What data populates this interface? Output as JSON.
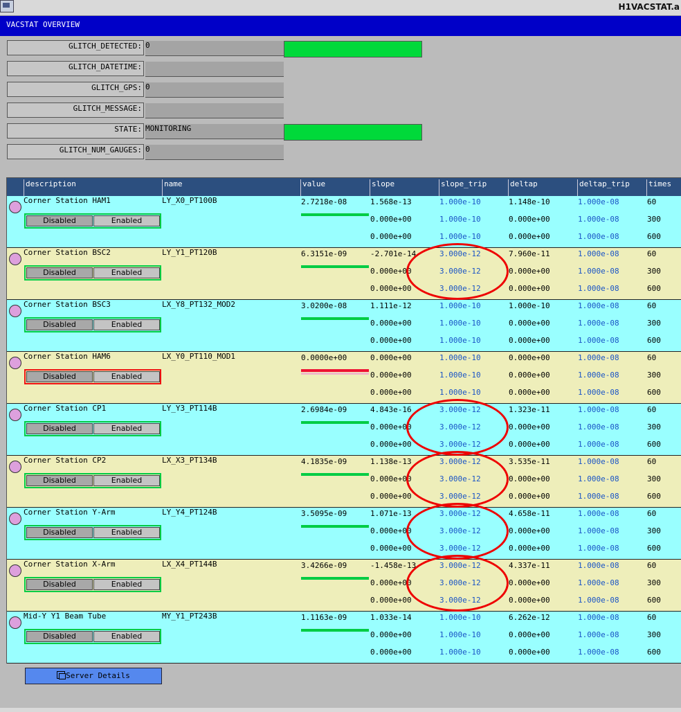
{
  "window": {
    "title": "H1VACSTAT.a"
  },
  "header": {
    "title": "VACSTAT OVERVIEW"
  },
  "fields": [
    {
      "label": "GLITCH_DETECTED:",
      "value": "0",
      "indicator_color": "#00d93a"
    },
    {
      "label": "GLITCH_DATETIME:",
      "value": ""
    },
    {
      "label": "GLITCH_GPS:",
      "value": "0"
    },
    {
      "label": "GLITCH_MESSAGE:",
      "value": ""
    },
    {
      "label": "STATE:",
      "value": "MONITORING",
      "indicator_color": "#00d93a"
    },
    {
      "label": "GLITCH_NUM_GAUGES:",
      "value": "0"
    }
  ],
  "table": {
    "columns": [
      "description",
      "name",
      "value",
      "slope",
      "slope_trip",
      "deltap",
      "deltap_trip",
      "times"
    ],
    "toggle": {
      "disabled_label": "Disabled",
      "enabled_label": "Enabled"
    },
    "rows": [
      {
        "description": "Corner Station HAM1",
        "name": "LY_X0_PT100B",
        "value": "2.7218e-08",
        "status": "ok",
        "slope": [
          "1.568e-13",
          "0.000e+00",
          "0.000e+00"
        ],
        "slope_trip": [
          "1.000e-10",
          "1.000e-10",
          "1.000e-10"
        ],
        "deltap": [
          "1.148e-10",
          "0.000e+00",
          "0.000e+00"
        ],
        "deltap_trip": [
          "1.000e-08",
          "1.000e-08",
          "1.000e-08"
        ],
        "times": [
          "60",
          "300",
          "600"
        ]
      },
      {
        "description": "Corner Station BSC2",
        "name": "LY_Y1_PT120B",
        "value": "6.3151e-09",
        "status": "ok",
        "slope": [
          "-2.701e-14",
          "0.000e+00",
          "0.000e+00"
        ],
        "slope_trip": [
          "3.000e-12",
          "3.000e-12",
          "3.000e-12"
        ],
        "deltap": [
          "7.960e-11",
          "0.000e+00",
          "0.000e+00"
        ],
        "deltap_trip": [
          "1.000e-08",
          "1.000e-08",
          "1.000e-08"
        ],
        "times": [
          "60",
          "300",
          "600"
        ]
      },
      {
        "description": "Corner Station BSC3",
        "name": "LX_Y8_PT132_MOD2",
        "value": "3.0200e-08",
        "status": "ok",
        "slope": [
          "1.111e-12",
          "0.000e+00",
          "0.000e+00"
        ],
        "slope_trip": [
          "1.000e-10",
          "1.000e-10",
          "1.000e-10"
        ],
        "deltap": [
          "1.000e-10",
          "0.000e+00",
          "0.000e+00"
        ],
        "deltap_trip": [
          "1.000e-08",
          "1.000e-08",
          "1.000e-08"
        ],
        "times": [
          "60",
          "300",
          "600"
        ]
      },
      {
        "description": "Corner Station HAM6",
        "name": "LX_Y0_PT110_MOD1",
        "value": "0.0000e+00",
        "status": "fault",
        "slope": [
          "0.000e+00",
          "0.000e+00",
          "0.000e+00"
        ],
        "slope_trip": [
          "1.000e-10",
          "1.000e-10",
          "1.000e-10"
        ],
        "deltap": [
          "0.000e+00",
          "0.000e+00",
          "0.000e+00"
        ],
        "deltap_trip": [
          "1.000e-08",
          "1.000e-08",
          "1.000e-08"
        ],
        "times": [
          "60",
          "300",
          "600"
        ]
      },
      {
        "description": "Corner Station CP1",
        "name": "LY_Y3_PT114B",
        "value": "2.6984e-09",
        "status": "ok",
        "slope": [
          "4.843e-16",
          "0.000e+00",
          "0.000e+00"
        ],
        "slope_trip": [
          "3.000e-12",
          "3.000e-12",
          "3.000e-12"
        ],
        "deltap": [
          "1.323e-11",
          "0.000e+00",
          "0.000e+00"
        ],
        "deltap_trip": [
          "1.000e-08",
          "1.000e-08",
          "1.000e-08"
        ],
        "times": [
          "60",
          "300",
          "600"
        ]
      },
      {
        "description": "Corner Station CP2",
        "name": "LX_X3_PT134B",
        "value": "4.1835e-09",
        "status": "ok",
        "slope": [
          "1.138e-13",
          "0.000e+00",
          "0.000e+00"
        ],
        "slope_trip": [
          "3.000e-12",
          "3.000e-12",
          "3.000e-12"
        ],
        "deltap": [
          "3.535e-11",
          "0.000e+00",
          "0.000e+00"
        ],
        "deltap_trip": [
          "1.000e-08",
          "1.000e-08",
          "1.000e-08"
        ],
        "times": [
          "60",
          "300",
          "600"
        ]
      },
      {
        "description": "Corner Station Y-Arm",
        "name": "LY_Y4_PT124B",
        "value": "3.5095e-09",
        "status": "ok",
        "slope": [
          "1.071e-13",
          "0.000e+00",
          "0.000e+00"
        ],
        "slope_trip": [
          "3.000e-12",
          "3.000e-12",
          "3.000e-12"
        ],
        "deltap": [
          "4.658e-11",
          "0.000e+00",
          "0.000e+00"
        ],
        "deltap_trip": [
          "1.000e-08",
          "1.000e-08",
          "1.000e-08"
        ],
        "times": [
          "60",
          "300",
          "600"
        ]
      },
      {
        "description": "Corner Station X-Arm",
        "name": "LX_X4_PT144B",
        "value": "3.4266e-09",
        "status": "ok",
        "slope": [
          "-1.458e-13",
          "0.000e+00",
          "0.000e+00"
        ],
        "slope_trip": [
          "3.000e-12",
          "3.000e-12",
          "3.000e-12"
        ],
        "deltap": [
          "4.337e-11",
          "0.000e+00",
          "0.000e+00"
        ],
        "deltap_trip": [
          "1.000e-08",
          "1.000e-08",
          "1.000e-08"
        ],
        "times": [
          "60",
          "300",
          "600"
        ]
      },
      {
        "description": "Mid-Y Y1 Beam Tube",
        "name": "MY_Y1_PT243B",
        "value": "1.1163e-09",
        "status": "ok",
        "slope": [
          "1.033e-14",
          "0.000e+00",
          "0.000e+00"
        ],
        "slope_trip": [
          "1.000e-10",
          "1.000e-10",
          "1.000e-10"
        ],
        "deltap": [
          "6.262e-12",
          "0.000e+00",
          "0.000e+00"
        ],
        "deltap_trip": [
          "1.000e-08",
          "1.000e-08",
          "1.000e-08"
        ],
        "times": [
          "60",
          "300",
          "600"
        ]
      }
    ]
  },
  "annotations": {
    "highlighted_rows": [
      1,
      4,
      5,
      6,
      7
    ],
    "color": "#ee0000"
  },
  "footer": {
    "server_details_label": "Server Details"
  },
  "colors": {
    "ok": "#00cc44",
    "fault": "#ee1111",
    "header_bg": "#0000c8",
    "table_header_bg": "#2c4f7f",
    "row_a": "#99ffff",
    "row_b": "#eeeeba",
    "trip_text": "#1a54c6"
  }
}
